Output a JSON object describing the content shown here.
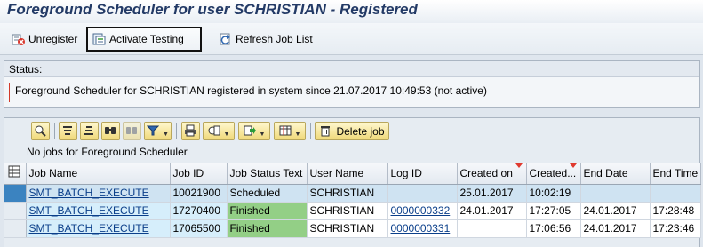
{
  "window": {
    "title": "Foreground Scheduler for user SCHRISTIAN - Registered"
  },
  "toolbar": {
    "unregister": {
      "label": "Unregister",
      "icon": "unregister-icon"
    },
    "activate_testing": {
      "label": "Activate Testing",
      "icon": "activate-testing-icon"
    },
    "refresh": {
      "label": "Refresh Job List",
      "icon": "refresh-icon"
    }
  },
  "status": {
    "title": "Status:",
    "text": "Foreground Scheduler for SCHRISTIAN registered in system since 21.07.2017 10:49:53 (not active)"
  },
  "alv": {
    "toolbar_icons": [
      "details-icon",
      "sort-ascending-icon",
      "sort-descending-icon",
      "find-icon",
      "find-next-icon",
      "filter-icon",
      "print-icon",
      "views-icon",
      "export-icon",
      "layout-icon"
    ],
    "delete_job_label": "Delete job",
    "caption": "No jobs for Foreground Scheduler",
    "columns": [
      "Job Name",
      "Job ID",
      "Job Status Text",
      "User Name",
      "Log ID",
      "Created on",
      "Created...",
      "End Date",
      "End Time"
    ],
    "rows": [
      {
        "job_name": "SMT_BATCH_EXECUTE",
        "job_id": "10021900",
        "status": "Scheduled",
        "user": "SCHRISTIAN",
        "log_id": "",
        "created_on": "25.01.2017",
        "created_time": "10:02:19",
        "end_date": "",
        "end_time": ""
      },
      {
        "job_name": "SMT_BATCH_EXECUTE",
        "job_id": "17270400",
        "status": "Finished",
        "user": "SCHRISTIAN",
        "log_id": "0000000332",
        "created_on": "24.01.2017",
        "created_time": "17:27:05",
        "end_date": "24.01.2017",
        "end_time": "17:28:48"
      },
      {
        "job_name": "SMT_BATCH_EXECUTE",
        "job_id": "17065500",
        "status": "Finished",
        "user": "SCHRISTIAN",
        "log_id": "0000000331",
        "created_on": "",
        "created_time": "17:06:56",
        "end_date": "24.01.2017",
        "end_time": "17:23:46"
      }
    ]
  },
  "colors": {
    "title_text": "#233a66",
    "finished_status": "#93cf86",
    "selected_row": "#cfe3f2",
    "row_selector": "#3b83c0",
    "sort_indicator": "#e03a2f",
    "status_marker": "#d23a2a"
  }
}
